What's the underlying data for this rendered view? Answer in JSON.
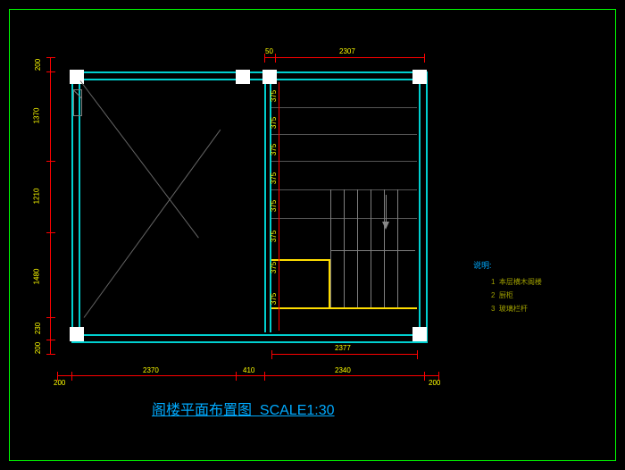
{
  "title": {
    "name": "阁楼平面布置图",
    "scale": "SCALE1:30"
  },
  "legend": {
    "heading": "说明:",
    "items": [
      {
        "num": "1",
        "text": "本层横木阁楼"
      },
      {
        "num": "2",
        "text": "厨柜"
      },
      {
        "num": "3",
        "text": "玻璃栏杆"
      }
    ]
  },
  "dims_top": {
    "d1": "50",
    "d2": "2307"
  },
  "dims_bottom_inner": {
    "d1": "2377"
  },
  "dims_bottom_outer": {
    "d0": "200",
    "d1": "2370",
    "d2": "410",
    "d3": "2340",
    "d4": "200"
  },
  "dims_left_outer": {
    "d0": "200",
    "d1": "1370",
    "d2": "1210",
    "d3": "1480",
    "d4": "230",
    "d5": "200"
  },
  "dims_right_inner": {
    "seg": "375"
  }
}
